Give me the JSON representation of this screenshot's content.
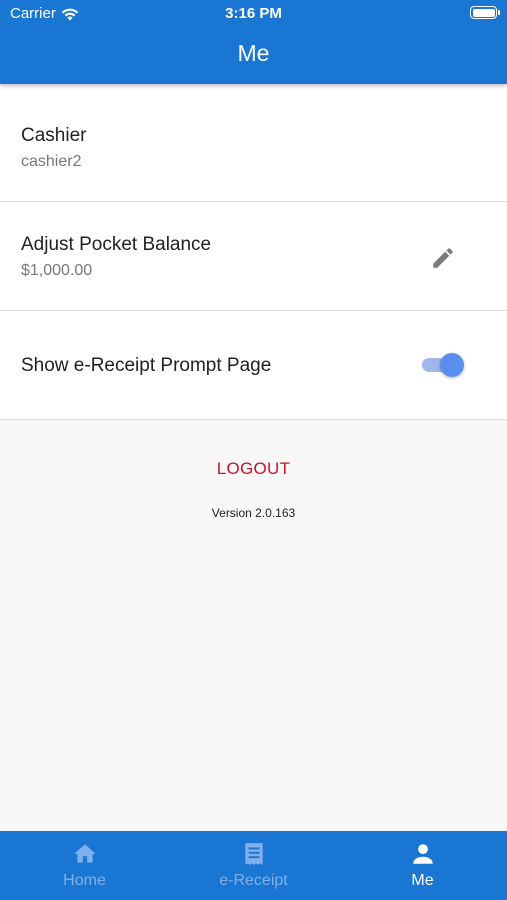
{
  "status_bar": {
    "carrier": "Carrier",
    "time": "3:16 PM"
  },
  "header": {
    "title": "Me"
  },
  "rows": [
    {
      "title": "Cashier",
      "subtitle": "cashier2"
    },
    {
      "title": "Adjust Pocket Balance",
      "subtitle": "$1,000.00",
      "action_icon": "pencil-icon"
    },
    {
      "title": "Show e-Receipt Prompt Page",
      "toggle_on": true
    }
  ],
  "logout_label": "LOGOUT",
  "version": "Version 2.0.163",
  "tabs": [
    {
      "label": "Home",
      "icon": "home-icon",
      "active": false
    },
    {
      "label": "e-Receipt",
      "icon": "receipt-icon",
      "active": false
    },
    {
      "label": "Me",
      "icon": "person-icon",
      "active": true
    }
  ],
  "colors": {
    "primary": "#1976d2",
    "logout": "#c2182b",
    "toggle": "#5b8def"
  }
}
